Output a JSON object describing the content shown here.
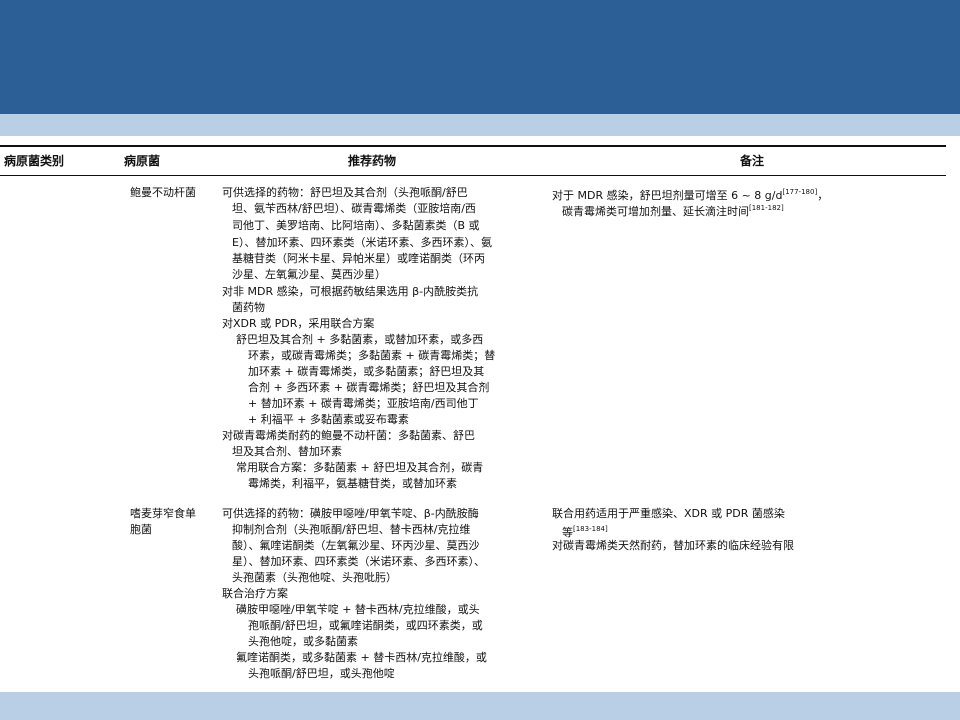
{
  "headers": {
    "category": "病原菌类别",
    "pathogen": "病原菌",
    "drugs": "推荐药物",
    "notes": "备注"
  },
  "acinetobacter": {
    "name": "鲍曼不动杆菌",
    "drugs": [
      "可供选择的药物：舒巴坦及其合剂（头孢哌酮/舒巴",
      "坦、氨苄西林/舒巴坦）、碳青霉烯类（亚胺培南/西",
      "司他丁、美罗培南、比阿培南）、多黏菌素类（B 或",
      "E）、替加环素、四环素类（米诺环素、多西环素）、氨",
      "基糖苷类（阿米卡星、异帕米星）或喹诺酮类（环丙",
      "沙星、左氧氟沙星、莫西沙星）",
      "对非 MDR 感染，可根据药敏结果选用 β-内酰胺类抗",
      "菌药物",
      "对XDR 或 PDR，采用联合方案",
      "舒巴坦及其合剂 + 多黏菌素，或替加环素，或多西",
      "环素，或碳青霉烯类；多黏菌素 + 碳青霉烯类；替",
      "加环素 + 碳青霉烯类，或多黏菌素；舒巴坦及其",
      "合剂 + 多西环素 + 碳青霉烯类；舒巴坦及其合剂",
      "+ 替加环素 + 碳青霉烯类；亚胺培南/西司他丁",
      "+ 利福平 + 多黏菌素或妥布霉素",
      "对碳青霉烯类耐药的鲍曼不动杆菌：多黏菌素、舒巴",
      "坦及其合剂、替加环素",
      "常用联合方案：多黏菌素 + 舒巴坦及其合剂，碳青",
      "霉烯类，利福平，氨基糖苷类，或替加环素"
    ],
    "note_line1": "对于 MDR 感染，舒巴坦剂量可增至 6 ~ 8 g/d",
    "note_ref1": "[177-180]",
    "note_line1_tail": "，",
    "note_line2": "碳青霉烯类可增加剂量、延长滴注时间",
    "note_ref2": "[181-182]"
  },
  "stenotrophomonas": {
    "name_line1": "嗜麦芽窄食单",
    "name_line2": "胞菌",
    "drugs": [
      "可供选择的药物：磺胺甲噁唑/甲氧苄啶、β-内酰胺酶",
      "抑制剂合剂（头孢哌酮/舒巴坦、替卡西林/克拉维",
      "酸）、氟喹诺酮类（左氧氟沙星、环丙沙星、莫西沙",
      "星）、替加环素、四环素类（米诺环素、多西环素）、",
      "头孢菌素（头孢他啶、头孢吡肟）",
      "联合治疗方案",
      "磺胺甲噁唑/甲氧苄啶 + 替卡西林/克拉维酸，或头",
      "孢哌酮/舒巴坦，或氟喹诺酮类，或四环素类，或",
      "头孢他啶，或多黏菌素",
      "氟喹诺酮类，或多黏菌素 + 替卡西林/克拉维酸，或",
      "头孢哌酮/舒巴坦，或头孢他啶"
    ],
    "note_line1": "联合用药适用于严重感染、XDR 或 PDR 菌感染",
    "note_line2": "等",
    "note_ref2": "[183-184]",
    "note_line3": "对碳青霉烯类天然耐药，替加环素的临床经验有限"
  }
}
